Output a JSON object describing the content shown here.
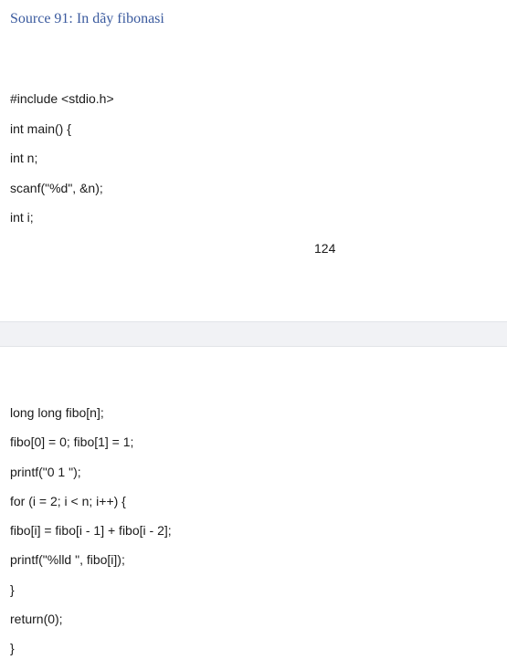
{
  "heading": "Source 91: In dãy fibonasi",
  "page_one_lines": [
    "#include <stdio.h>",
    "int main() {",
    "int n;",
    "scanf(\"%d\", &n);",
    "int i;"
  ],
  "page_number": "124",
  "page_two_lines": [
    "long long fibo[n];",
    "fibo[0] = 0; fibo[1] = 1;",
    "printf(\"0 1 \");",
    "for (i = 2; i < n; i++) {",
    "fibo[i] = fibo[i - 1] + fibo[i - 2];",
    "printf(\"%lld \", fibo[i]);",
    "}",
    "return(0);",
    "}"
  ]
}
